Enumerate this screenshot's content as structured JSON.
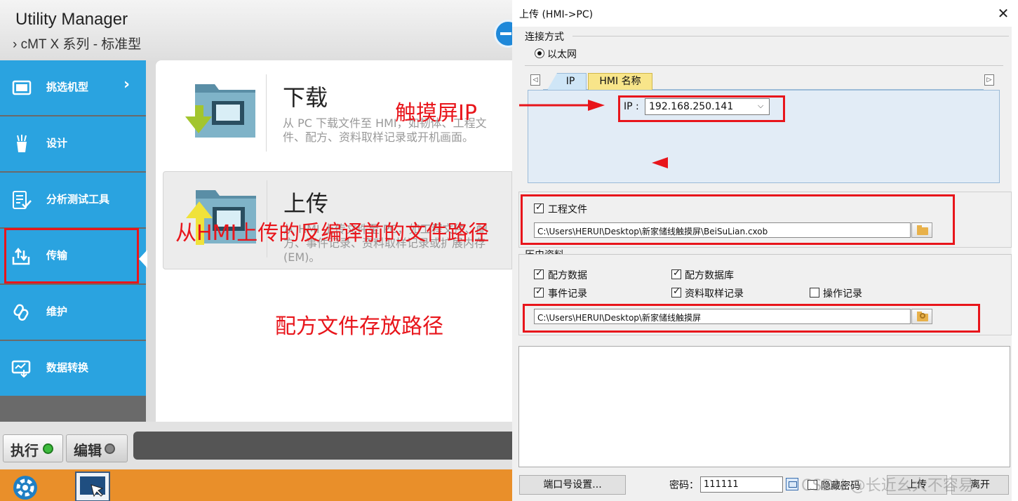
{
  "utility_manager": {
    "title": "Utility Manager",
    "subtitle": "› cMT X 系列 - 标准型",
    "sidebar": {
      "items": [
        {
          "label": "挑选机型",
          "chevron": "›"
        },
        {
          "label": "设计"
        },
        {
          "label": "分析测试工具"
        },
        {
          "label": "传输",
          "active": true
        },
        {
          "label": "维护"
        },
        {
          "label": "数据转换"
        }
      ]
    },
    "operations": [
      {
        "title": "下载",
        "description": "从 PC 下载文件至 HMI，如韧体、工程文件、配方、资料取样记录或开机画面。"
      },
      {
        "title": "上传",
        "description": "从 HMI 上传文件至 PC，如工程文件、配方、事件记录、资料取样记录或扩展内存 (EM)。"
      }
    ],
    "bottom": {
      "run_label": "执行",
      "edit_label": "编辑"
    },
    "colors": {
      "sidebar": "#2aa3e0",
      "run_dot": "#3dbb3d",
      "edit_dot": "#888888"
    }
  },
  "dialog": {
    "title": "上传 (HMI->PC)",
    "close_glyph": "✕",
    "connection": {
      "section_label": "连接方式",
      "radio_label": "以太网",
      "tab_left_arrow": "◁",
      "tab_right_arrow": "▷",
      "tabs": [
        "IP",
        "HMI 名称"
      ],
      "ip_label": "IP :",
      "ip_value": "192.168.250.141",
      "caret": "⌵"
    },
    "project_file": {
      "checkbox_label": "工程文件",
      "checked": true,
      "path": "C:\\Users\\HERUI\\Desktop\\新家储线触摸屏\\BeiSuLian.cxob"
    },
    "history": {
      "section_label": "历史资料",
      "options": [
        {
          "label": "配方数据",
          "checked": true
        },
        {
          "label": "配方数据库",
          "checked": true
        },
        {
          "label": "事件记录",
          "checked": true
        },
        {
          "label": "资料取样记录",
          "checked": true
        },
        {
          "label": "操作记录",
          "checked": false
        }
      ],
      "path": "C:\\Users\\HERUI\\Desktop\\新家储线触摸屏"
    },
    "footer": {
      "port_button": "端口号设置...",
      "password_label": "密码：",
      "password_value": "111111",
      "hide_password_label": "隐藏密码",
      "upload_button": "上传",
      "exit_button": "离开"
    },
    "watermark": "CSDN @长近幺大不容易"
  },
  "annotations": {
    "ip_note": "触摸屏IP",
    "project_path_note": "从HMI上传的反编译前的文件路径",
    "recipe_path_note": "配方文件存放路径",
    "color": "#e8151b"
  }
}
